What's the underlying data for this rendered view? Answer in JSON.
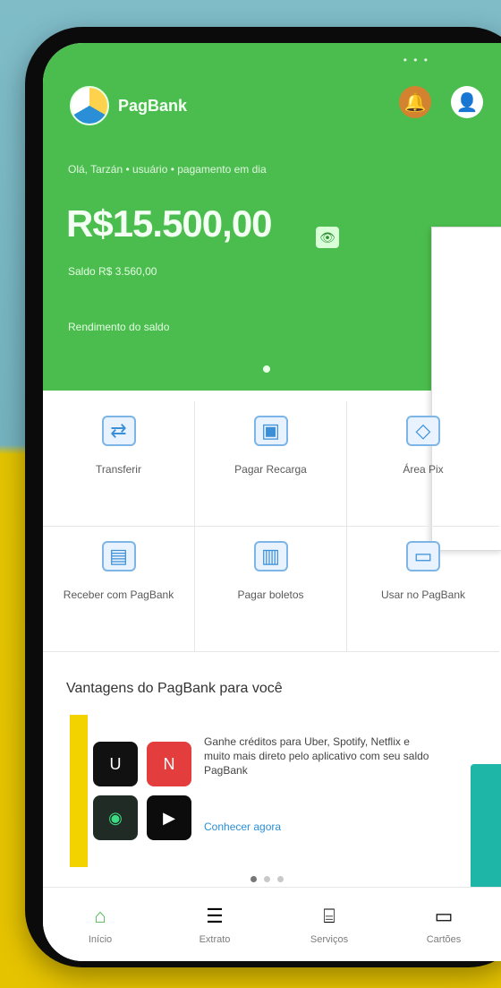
{
  "status": {
    "dots": "• • •"
  },
  "header": {
    "app_name": "PagBank",
    "greeting": "Olá, Tarzán • usuário • pagamento em dia",
    "balance": "R$15.500,00",
    "subline": "Saldo R$ 3.560,00",
    "yield": "Rendimento do saldo",
    "icons": {
      "bell": "bell-icon",
      "avatar": "user-icon"
    }
  },
  "grid": {
    "items": [
      {
        "label": "Transferir",
        "icon": "transfer-icon"
      },
      {
        "label": "Pagar Recarga",
        "icon": "wallet-icon"
      },
      {
        "label": "Área Pix",
        "icon": "pix-icon"
      },
      {
        "label": "Receber com PagBank",
        "icon": "receive-icon"
      },
      {
        "label": "Pagar boletos",
        "icon": "barcode-icon"
      },
      {
        "label": "Usar no PagBank",
        "icon": "card-icon"
      }
    ]
  },
  "section": {
    "title": "Vantagens do PagBank para você"
  },
  "promo": {
    "text": "Ganhe créditos para Uber, Spotify, Netflix e muito mais direto pelo aplicativo com seu saldo PagBank",
    "link": "Conhecer agora",
    "tiles": [
      "uber",
      "netflix",
      "spotify",
      "video"
    ]
  },
  "nav": {
    "items": [
      {
        "label": "Início",
        "icon": "home-icon",
        "active": true
      },
      {
        "label": "Extrato",
        "icon": "statement-icon",
        "active": false
      },
      {
        "label": "Serviços",
        "icon": "store-icon",
        "active": false
      },
      {
        "label": "Cartões",
        "icon": "card-icon",
        "active": false
      }
    ]
  },
  "colors": {
    "primary_green": "#4bbd4e",
    "accent_yellow": "#f2d300",
    "link_blue": "#2a8fd6",
    "teal": "#1eb6a6"
  }
}
